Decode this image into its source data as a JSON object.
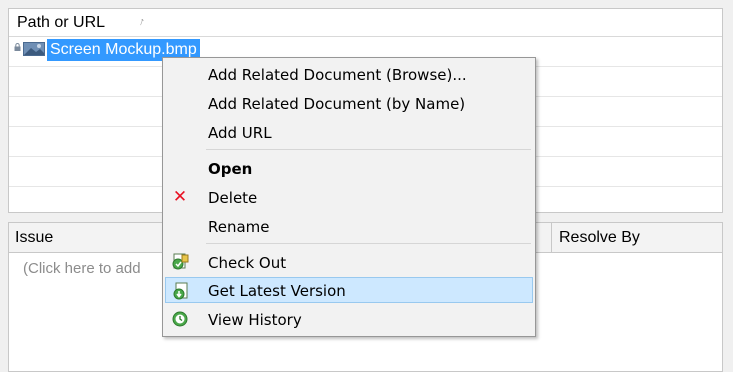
{
  "documents": {
    "column_path": "Path or URL",
    "sort_indicator": "↑",
    "file": {
      "name": "Screen Mockup.bmp",
      "icons": [
        "lock-icon",
        "image-file-icon"
      ]
    }
  },
  "issues": {
    "column_issue": "Issue",
    "column_resolve_by": "Resolve By",
    "placeholder": "(Click here to add"
  },
  "context_menu": {
    "items": [
      {
        "label": "Add Related Document (Browse)..."
      },
      {
        "label": "Add Related Document (by Name)"
      },
      {
        "label": "Add URL"
      },
      {
        "label": "Open",
        "bold": true
      },
      {
        "label": "Delete",
        "icon": "delete-x-icon"
      },
      {
        "label": "Rename"
      },
      {
        "label": "Check Out",
        "icon": "check-out-icon"
      },
      {
        "label": "Get Latest Version",
        "icon": "get-latest-version-icon",
        "highlighted": true
      },
      {
        "label": "View History",
        "icon": "view-history-icon"
      }
    ],
    "delete_glyph": "✕"
  },
  "colors": {
    "selection": "#3399ff",
    "menu_highlight": "#cde8ff",
    "delete_red": "#e81123"
  }
}
